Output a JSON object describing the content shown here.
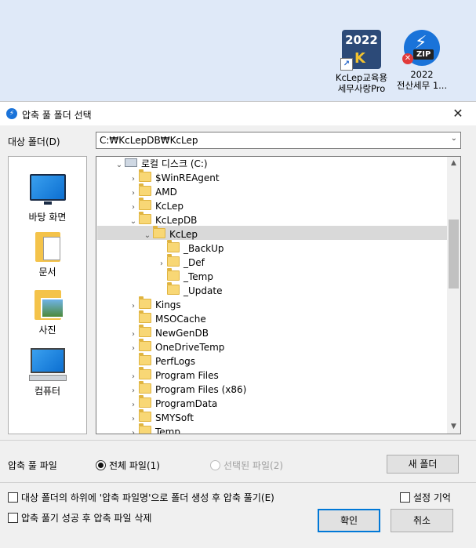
{
  "desktop": {
    "icons": [
      {
        "icon": "kclep-2022-icon",
        "badge": "2022",
        "line1": "KcLep교육용",
        "line2": "세무사랑Pro"
      },
      {
        "icon": "zip-app-icon",
        "badge": "ZIP",
        "line1": "2022",
        "line2": "전산세무 1..."
      }
    ]
  },
  "dialog": {
    "title": "압축 풀 폴더 선택",
    "target_label": "대상 폴더(D)",
    "target_path": "C:₩KcLepDB₩KcLep",
    "places": [
      "바탕 화면",
      "문서",
      "사진",
      "컴퓨터"
    ],
    "tree": [
      {
        "label": "로컬 디스크 (C:)",
        "depth": 0,
        "expanded": true,
        "type": "drive"
      },
      {
        "label": "$WinREAgent",
        "depth": 1,
        "expanded": false
      },
      {
        "label": "AMD",
        "depth": 1,
        "expanded": false
      },
      {
        "label": "KcLep",
        "depth": 1,
        "expanded": false
      },
      {
        "label": "KcLepDB",
        "depth": 1,
        "expanded": true
      },
      {
        "label": "KcLep",
        "depth": 2,
        "expanded": true,
        "selected": true
      },
      {
        "label": "_BackUp",
        "depth": 3,
        "leaf": true
      },
      {
        "label": "_Def",
        "depth": 3,
        "expanded": false
      },
      {
        "label": "_Temp",
        "depth": 3,
        "leaf": true
      },
      {
        "label": "_Update",
        "depth": 3,
        "leaf": true
      },
      {
        "label": "Kings",
        "depth": 1,
        "expanded": false
      },
      {
        "label": "MSOCache",
        "depth": 1,
        "leaf": true
      },
      {
        "label": "NewGenDB",
        "depth": 1,
        "expanded": false
      },
      {
        "label": "OneDriveTemp",
        "depth": 1,
        "expanded": false
      },
      {
        "label": "PerfLogs",
        "depth": 1,
        "leaf": true
      },
      {
        "label": "Program Files",
        "depth": 1,
        "expanded": false
      },
      {
        "label": "Program Files (x86)",
        "depth": 1,
        "expanded": false
      },
      {
        "label": "ProgramData",
        "depth": 1,
        "expanded": false
      },
      {
        "label": "SMYSoft",
        "depth": 1,
        "expanded": false
      },
      {
        "label": "Temp",
        "depth": 1,
        "expanded": false
      }
    ],
    "files_label": "압축 풀 파일",
    "radio_all": "전체 파일(1)",
    "radio_selected": "선택된 파일(2)",
    "new_folder": "새 폴더",
    "chk_subfolder": "대상 폴더의 하위에 '압축 파일명'으로 폴더 생성 후 압축 풀기(E)",
    "chk_remember": "설정 기억",
    "chk_delete": "압축 풀기 성공 후 압축 파일 삭제",
    "ok": "확인",
    "cancel": "취소"
  }
}
